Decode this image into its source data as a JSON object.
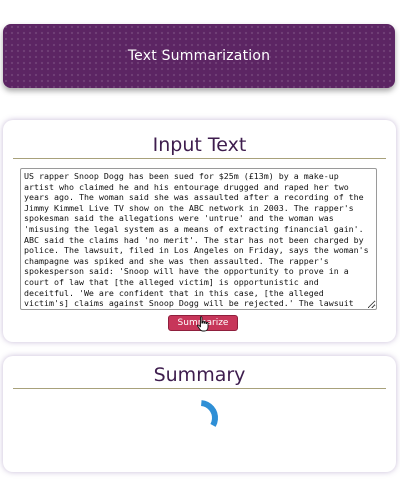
{
  "header": {
    "title": "Text Summarization"
  },
  "input_section": {
    "title": "Input Text",
    "text": "US rapper Snoop Dogg has been sued for $25m (£13m) by a make-up artist who claimed he and his entourage drugged and raped her two years ago. The woman said she was assaulted after a recording of the Jimmy Kimmel Live TV show on the ABC network in 2003. The rapper's spokesman said the allegations were 'untrue' and the woman was 'misusing the legal system as a means of extracting financial gain'. ABC said the claims had 'no merit'. The star has not been charged by police. The lawsuit, filed in Los Angeles on Friday, says the woman's champagne was spiked and she was then assaulted. The rapper's spokesperson said: 'Snoop will have the opportunity to prove in a court of law that [the alleged victim] is opportunistic and deceitful. 'We are confident that in this case, [the alleged victim's] claims against Snoop Dogg will be rejected.' The lawsuit names Snoop Dogg - real name Calvin Broadus - plus three associates, The Walt Disney Company and its parent company ABC Inc.",
    "button_label": "Summarize"
  },
  "summary_section": {
    "title": "Summary",
    "status": "loading"
  },
  "colors": {
    "header_bg": "#5c2563",
    "title_text": "#3e1d4e",
    "button_bg": "#c7365a",
    "spinner_arc": "#2e8fd6"
  },
  "icons": {
    "cursor": "hand-pointer-icon",
    "spinner": "loading-spinner-icon"
  }
}
